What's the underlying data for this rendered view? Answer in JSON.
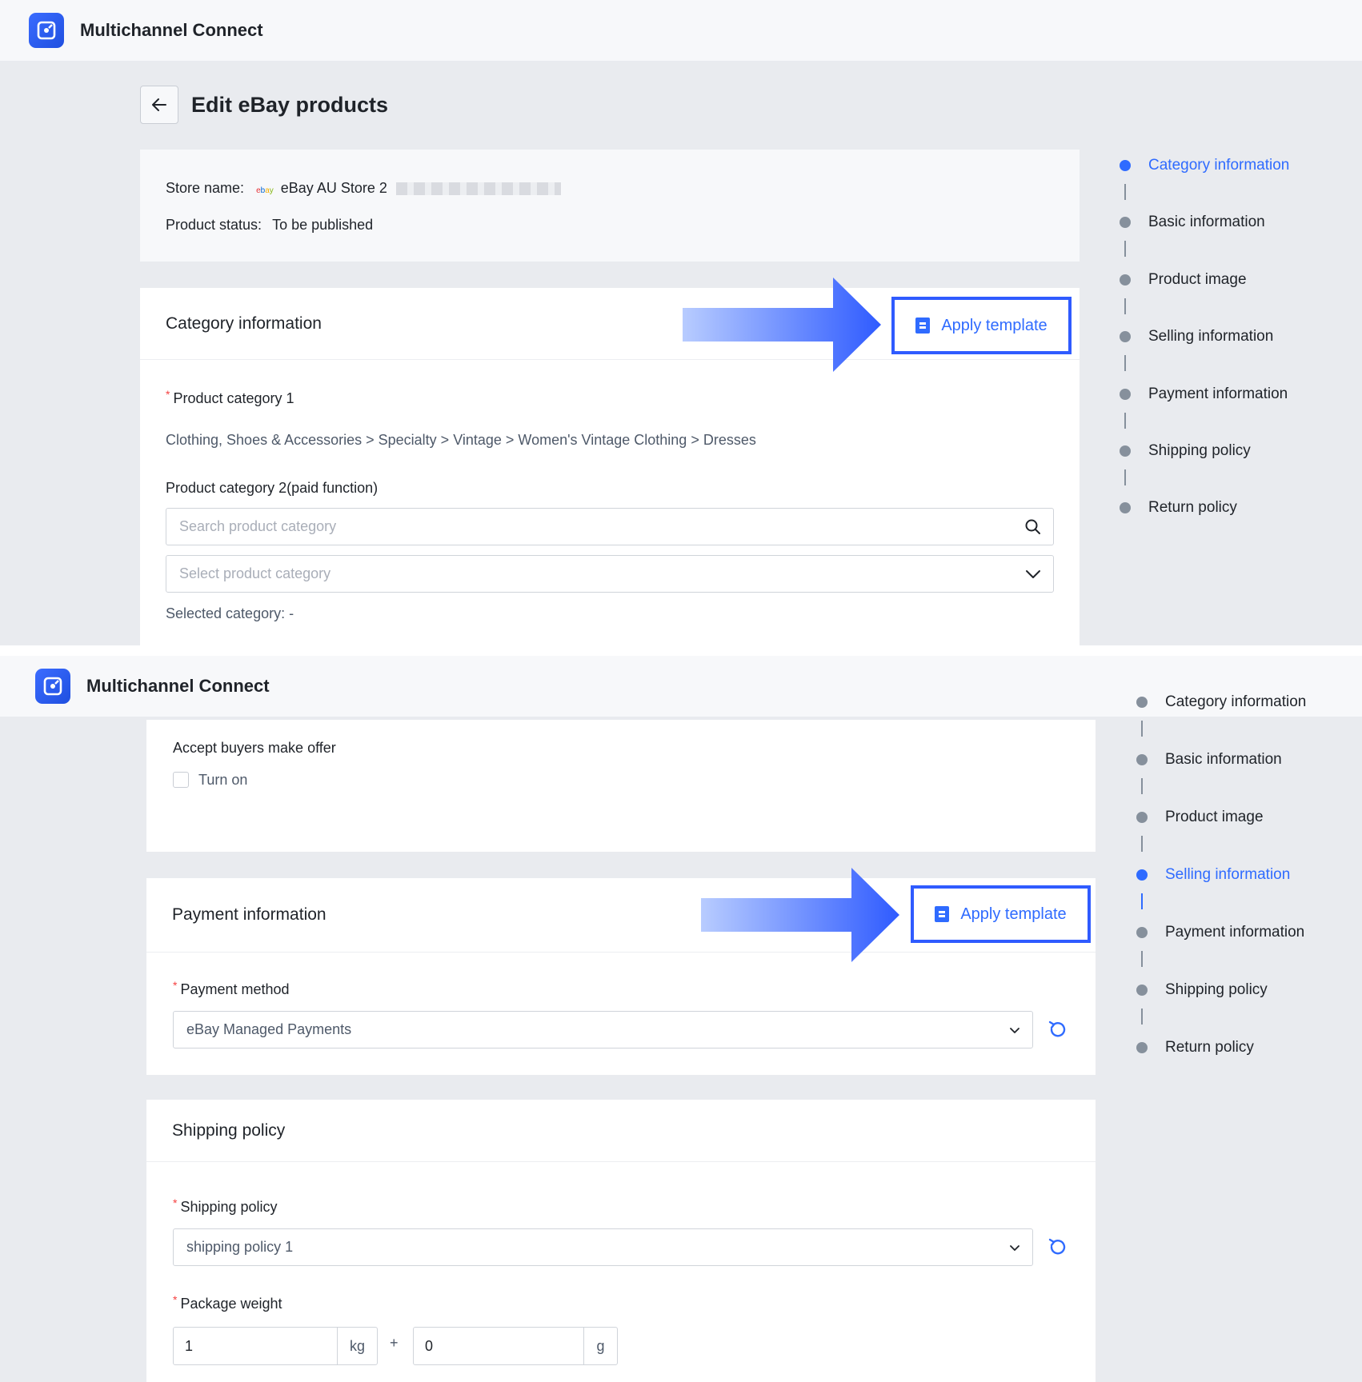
{
  "app": {
    "name": "Multichannel Connect"
  },
  "page": {
    "title": "Edit eBay products"
  },
  "store": {
    "name_label": "Store name:",
    "name_value": "eBay AU Store 2",
    "status_label": "Product status:",
    "status_value": "To be published"
  },
  "category_section": {
    "title": "Category information",
    "apply_template": "Apply template",
    "cat1_label": "Product category 1",
    "cat1_path": "Clothing, Shoes & Accessories > Specialty > Vintage > Women's Vintage Clothing > Dresses",
    "cat2_label": "Product category 2(paid function)",
    "search_placeholder": "Search product category",
    "select_placeholder": "Select product category",
    "selected_text": "Selected category: -"
  },
  "offer_section": {
    "label": "Accept buyers make offer",
    "checkbox_label": "Turn on",
    "checked": false
  },
  "payment_section": {
    "title": "Payment information",
    "apply_template": "Apply template",
    "method_label": "Payment method",
    "method_value": "eBay Managed Payments"
  },
  "shipping_section": {
    "title": "Shipping policy",
    "policy_label": "Shipping policy",
    "policy_value": "shipping policy 1",
    "weight_label": "Package weight",
    "weight_kg": "1",
    "kg_unit": "kg",
    "plus": "+",
    "weight_g": "0",
    "g_unit": "g"
  },
  "steps_top": {
    "active_index": 0,
    "items": [
      "Category information",
      "Basic information",
      "Product image",
      "Selling information",
      "Payment information",
      "Shipping policy",
      "Return policy"
    ]
  },
  "steps_bottom": {
    "active_index": 3,
    "items": [
      "Category information",
      "Basic information",
      "Product image",
      "Selling information",
      "Payment information",
      "Shipping policy",
      "Return policy"
    ]
  },
  "colors": {
    "accent": "#2f6bff",
    "highlight_border": "#2f5bff",
    "required": "#f53f3f"
  },
  "icons": [
    "back-arrow-icon",
    "ebay-logo-icon",
    "template-icon",
    "search-icon",
    "chevron-down-icon",
    "reset-icon"
  ]
}
